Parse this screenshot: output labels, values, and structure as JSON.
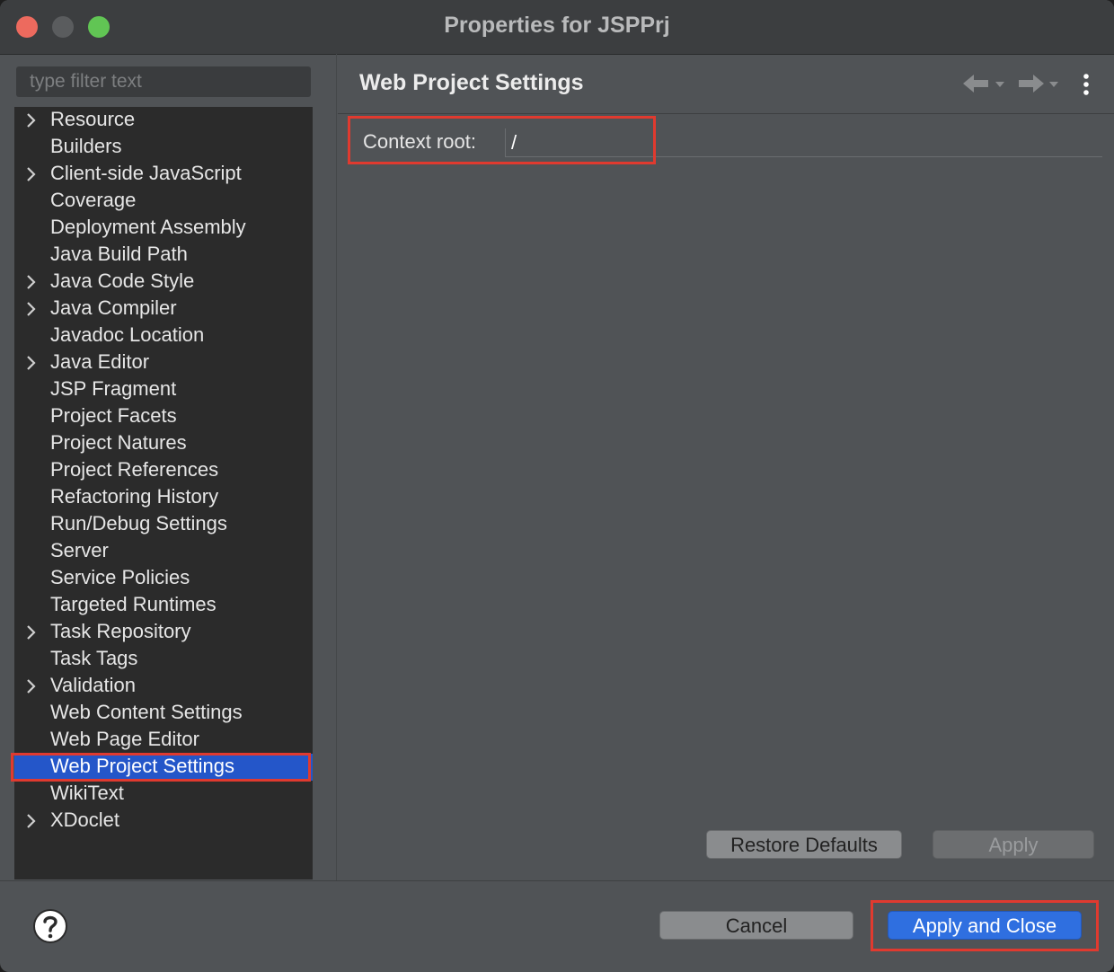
{
  "window": {
    "title": "Properties for JSPPrj"
  },
  "sidebar": {
    "filter_placeholder": "type filter text",
    "items": [
      {
        "label": "Resource",
        "expandable": true
      },
      {
        "label": "Builders",
        "expandable": false
      },
      {
        "label": "Client-side JavaScript",
        "expandable": true
      },
      {
        "label": "Coverage",
        "expandable": false
      },
      {
        "label": "Deployment Assembly",
        "expandable": false
      },
      {
        "label": "Java Build Path",
        "expandable": false
      },
      {
        "label": "Java Code Style",
        "expandable": true
      },
      {
        "label": "Java Compiler",
        "expandable": true
      },
      {
        "label": "Javadoc Location",
        "expandable": false
      },
      {
        "label": "Java Editor",
        "expandable": true
      },
      {
        "label": "JSP Fragment",
        "expandable": false
      },
      {
        "label": "Project Facets",
        "expandable": false
      },
      {
        "label": "Project Natures",
        "expandable": false
      },
      {
        "label": "Project References",
        "expandable": false
      },
      {
        "label": "Refactoring History",
        "expandable": false
      },
      {
        "label": "Run/Debug Settings",
        "expandable": false
      },
      {
        "label": "Server",
        "expandable": false
      },
      {
        "label": "Service Policies",
        "expandable": false
      },
      {
        "label": "Targeted Runtimes",
        "expandable": false
      },
      {
        "label": "Task Repository",
        "expandable": true
      },
      {
        "label": "Task Tags",
        "expandable": false
      },
      {
        "label": "Validation",
        "expandable": true
      },
      {
        "label": "Web Content Settings",
        "expandable": false
      },
      {
        "label": "Web Page Editor",
        "expandable": false
      },
      {
        "label": "Web Project Settings",
        "expandable": false,
        "selected": true
      },
      {
        "label": "WikiText",
        "expandable": false
      },
      {
        "label": "XDoclet",
        "expandable": true
      }
    ]
  },
  "page": {
    "title": "Web Project Settings",
    "context_root_label": "Context root:",
    "context_root_value": "/",
    "restore_defaults_label": "Restore Defaults",
    "apply_label": "Apply"
  },
  "footer": {
    "cancel_label": "Cancel",
    "apply_close_label": "Apply and Close"
  },
  "colors": {
    "selection": "#2456c9",
    "highlight": "#e03a2f",
    "primary_button": "#2f6fe0"
  }
}
